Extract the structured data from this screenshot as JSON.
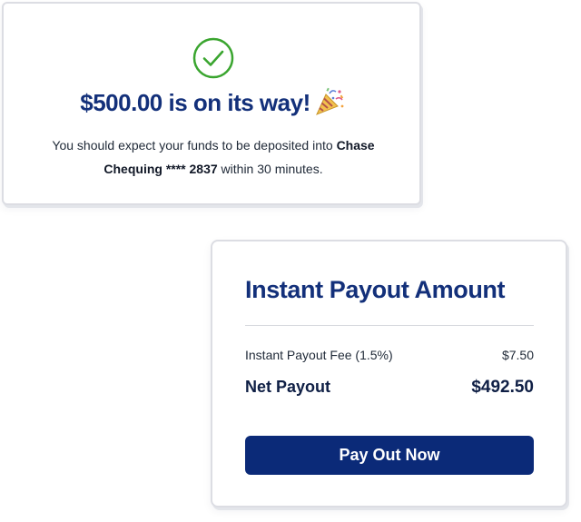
{
  "success_card": {
    "icon": "check-circle-icon",
    "title": "$500.00 is on its way!",
    "celebration_icon": "party-popper-icon",
    "message_before": "You should expect your funds to be deposited into ",
    "account": "Chase Chequing **** 2837",
    "message_after": " within 30 minutes."
  },
  "payout_card": {
    "title": "Instant Payout Amount",
    "fee_label": "Instant Payout Fee (1.5%)",
    "fee_value": "$7.50",
    "net_label": "Net Payout",
    "net_value": "$492.50",
    "button_label": "Pay Out Now"
  },
  "colors": {
    "brand_navy": "#13307a",
    "button": "#0b2a78",
    "success_green": "#3aa52f"
  }
}
